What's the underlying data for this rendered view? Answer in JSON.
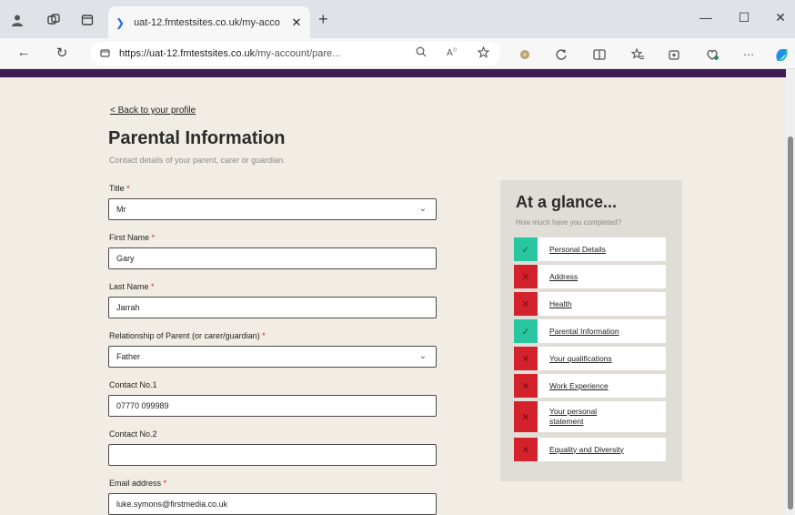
{
  "browser": {
    "tab_title": "uat-12.fmtestsites.co.uk/my-acco",
    "tab_close": "✕",
    "new_tab": "+",
    "url_domain": "https://uat-12.fmtestsites.co.uk",
    "url_path": "/my-account/pare...",
    "window_minimize": "—",
    "window_maximize": "☐",
    "window_close": "✕"
  },
  "page": {
    "back_link": "< Back to your profile",
    "title": "Parental Information",
    "subtitle": "Contact details of your parent, carer or guardian.",
    "required_marker": "*",
    "fields": [
      {
        "label": "Title",
        "required": true,
        "value": "Mr",
        "type": "select"
      },
      {
        "label": "First Name",
        "required": true,
        "value": "Gary",
        "type": "text"
      },
      {
        "label": "Last Name",
        "required": true,
        "value": "Jarrah",
        "type": "text"
      },
      {
        "label": "Relationship of Parent (or carer/guardian)",
        "required": true,
        "value": "Father",
        "type": "select"
      },
      {
        "label": "Contact No.1",
        "required": false,
        "value": "07770 099989",
        "type": "text"
      },
      {
        "label": "Contact No.2",
        "required": false,
        "value": "",
        "type": "text"
      },
      {
        "label": "Email address",
        "required": true,
        "value": "luke.symons@firstmedia.co.uk",
        "type": "text"
      }
    ]
  },
  "glance": {
    "title": "At a glance...",
    "subtitle": "How much have you completed?",
    "items": [
      {
        "label": "Personal Details",
        "status": "complete"
      },
      {
        "label": "Address",
        "status": "incomplete"
      },
      {
        "label": "Health",
        "status": "incomplete"
      },
      {
        "label": "Parental Information",
        "status": "complete"
      },
      {
        "label": "Your qualifications",
        "status": "incomplete"
      },
      {
        "label": "Work Experience",
        "status": "incomplete"
      },
      {
        "label": "Your personal statement",
        "status": "incomplete"
      },
      {
        "label": "Equality and Diversity",
        "status": "incomplete"
      }
    ]
  },
  "colors": {
    "accent_strip": "#3d1d52",
    "page_background": "#f1ede4",
    "panel_background": "#e0dcd6",
    "complete": "#29c7a1",
    "incomplete": "#d3222b",
    "required": "#c0272d"
  },
  "icons": {
    "check": "✓",
    "cross": "✕",
    "chevron": "⌄"
  }
}
